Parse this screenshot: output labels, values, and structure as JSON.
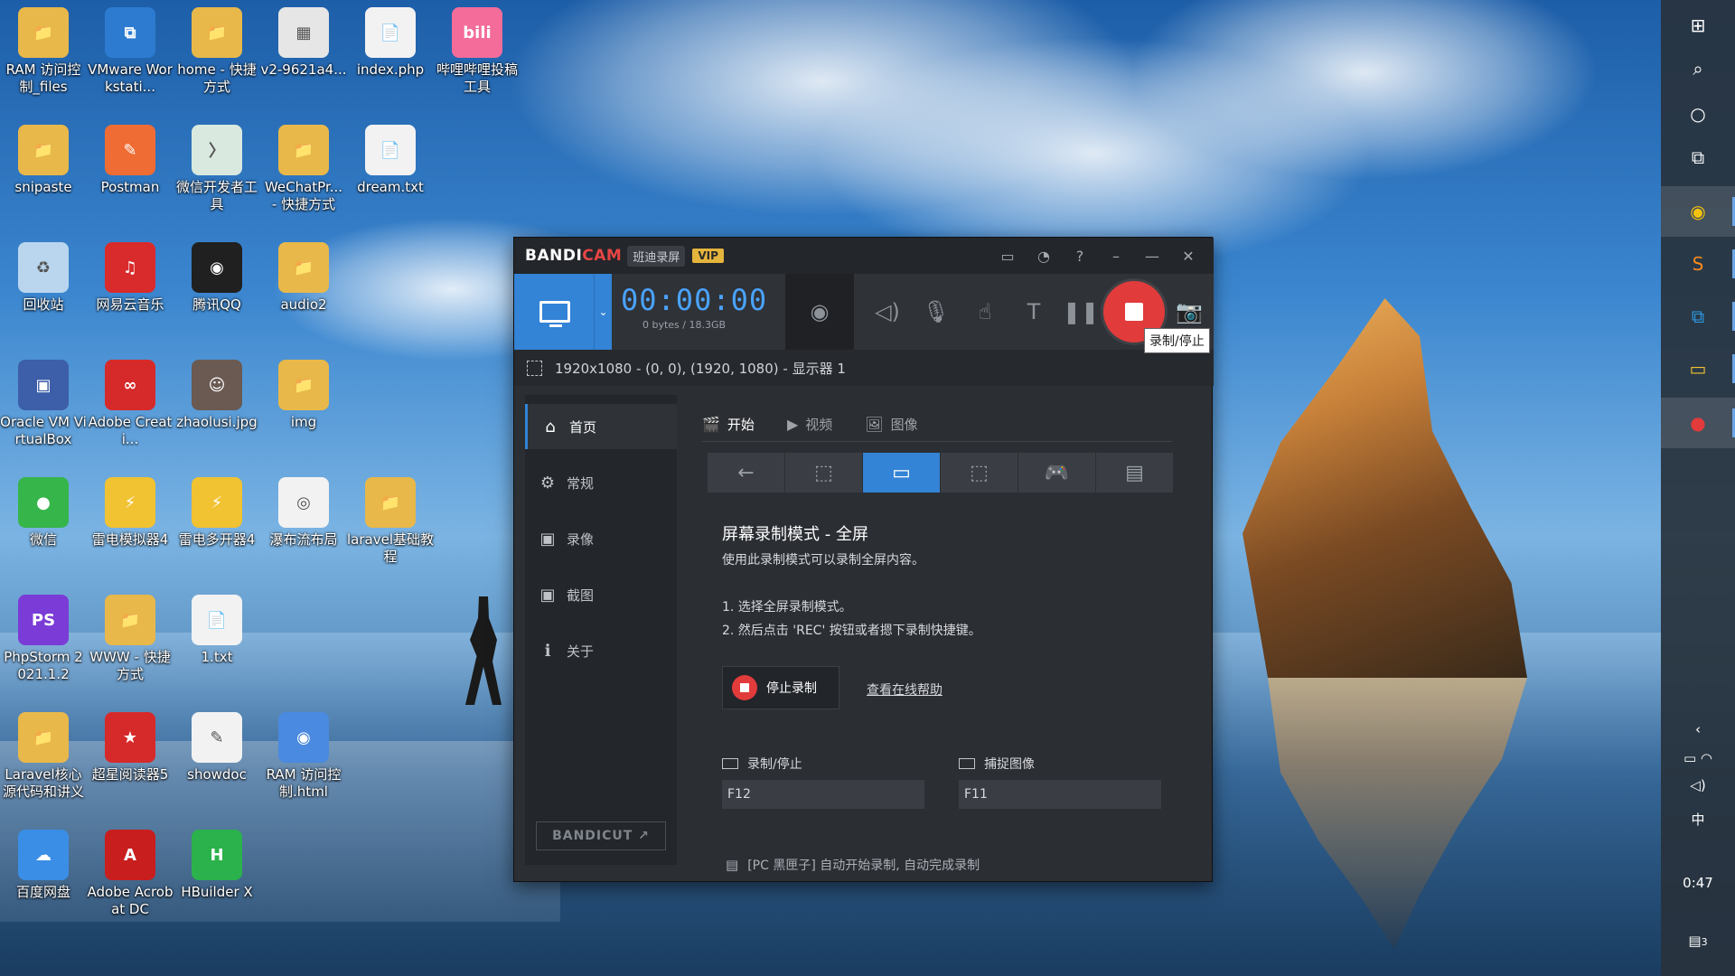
{
  "desktop": {
    "icons": [
      {
        "label": "RAM 访问控制_files",
        "glyph": "📁",
        "color": "#e8b84a"
      },
      {
        "label": "VMware Workstati...",
        "glyph": "⧉",
        "color": "#2c7bd1"
      },
      {
        "label": "home - 快捷方式",
        "glyph": "📁",
        "color": "#e8b84a"
      },
      {
        "label": "v2-9621a4...",
        "glyph": "▦",
        "color": "#e6e6e6"
      },
      {
        "label": "index.php",
        "glyph": "📄",
        "color": "#f2f2f2"
      },
      {
        "label": "哔哩哔哩投稿工具",
        "glyph": "bili",
        "color": "#f36c9a"
      },
      {
        "label": "snipaste",
        "glyph": "📁",
        "color": "#e8b84a"
      },
      {
        "label": "Postman",
        "glyph": "✎",
        "color": "#ef6c35"
      },
      {
        "label": "微信开发者工具",
        "glyph": "〉",
        "color": "#d9e9e0"
      },
      {
        "label": "WeChatPr... - 快捷方式",
        "glyph": "📁",
        "color": "#e8b84a"
      },
      {
        "label": "dream.txt",
        "glyph": "📄",
        "color": "#f2f2f2"
      },
      {
        "label": "回收站",
        "glyph": "♻",
        "color": "#b9d6ee"
      },
      {
        "label": "网易云音乐",
        "glyph": "♫",
        "color": "#d92b2b"
      },
      {
        "label": "腾讯QQ",
        "glyph": "◉",
        "color": "#202020"
      },
      {
        "label": "audio2",
        "glyph": "📁",
        "color": "#e8b84a"
      },
      {
        "label": "Oracle VM VirtualBox",
        "glyph": "▣",
        "color": "#3d5ea8"
      },
      {
        "label": "Adobe Creati...",
        "glyph": "∞",
        "color": "#d62a2a"
      },
      {
        "label": "zhaolusi.jpg",
        "glyph": "☺",
        "color": "#6b5a52"
      },
      {
        "label": "img",
        "glyph": "📁",
        "color": "#e8b84a"
      },
      {
        "label": "微信",
        "glyph": "●",
        "color": "#36b54a"
      },
      {
        "label": "雷电模拟器4",
        "glyph": "⚡",
        "color": "#f1c232"
      },
      {
        "label": "雷电多开器4",
        "glyph": "⚡",
        "color": "#f1c232"
      },
      {
        "label": "瀑布流布局",
        "glyph": "◎",
        "color": "#f2f2f2"
      },
      {
        "label": "laravel基础教程",
        "glyph": "📁",
        "color": "#e8b84a"
      },
      {
        "label": "PhpStorm 2021.1.2",
        "glyph": "PS",
        "color": "#7a3bd6"
      },
      {
        "label": "WWW - 快捷方式",
        "glyph": "📁",
        "color": "#e8b84a"
      },
      {
        "label": "1.txt",
        "glyph": "📄",
        "color": "#f2f2f2"
      },
      {
        "label": "Laravel核心源代码和讲义",
        "glyph": "📁",
        "color": "#e8b84a"
      },
      {
        "label": "超星阅读器5",
        "glyph": "★",
        "color": "#d62a2a"
      },
      {
        "label": "showdoc",
        "glyph": "✎",
        "color": "#f2f2f2"
      },
      {
        "label": "RAM 访问控制.html",
        "glyph": "◉",
        "color": "#4a8ae0"
      },
      {
        "label": "百度网盘",
        "glyph": "☁",
        "color": "#3a8ee6"
      },
      {
        "label": "Adobe Acrobat DC",
        "glyph": "A",
        "color": "#c81e1e"
      },
      {
        "label": "HBuilder X",
        "glyph": "H",
        "color": "#2bb24c"
      }
    ]
  },
  "taskbar": {
    "start_icon": "windows-logo-icon",
    "time": "0:47",
    "ime": "中",
    "notification_count": "3"
  },
  "bandicam": {
    "logo_main": "BANDI",
    "logo_accent": "CAM",
    "cn_name": "班迪录屏",
    "vip": "VIP",
    "timer": "00:00:00",
    "size": "0 bytes / 18.3GB",
    "tooltip": "录制/停止",
    "region_text": "1920x1080 - (0, 0), (1920, 1080) - 显示器 1",
    "nav": [
      {
        "label": "首页",
        "icon": "home-icon",
        "glyph": "⌂"
      },
      {
        "label": "常规",
        "icon": "gear-icon",
        "glyph": "⚙"
      },
      {
        "label": "录像",
        "icon": "video-settings-icon",
        "glyph": "▣"
      },
      {
        "label": "截图",
        "icon": "screenshot-settings-icon",
        "glyph": "▣"
      },
      {
        "label": "关于",
        "icon": "info-icon",
        "glyph": "ℹ"
      }
    ],
    "bandicut": "BANDICUT ↗",
    "tabs": [
      {
        "label": "开始",
        "glyph": "🎬"
      },
      {
        "label": "视频",
        "glyph": "▶"
      },
      {
        "label": "图像",
        "glyph": "🖼"
      }
    ],
    "mode_heading": "屏幕录制模式 - 全屏",
    "mode_desc": "使用此录制模式可以录制全屏内容。",
    "step1": "1. 选择全屏录制模式。",
    "step2": "2. 然后点击 'REC' 按钮或者摁下录制快捷键。",
    "stop_button": "停止录制",
    "help_link": "查看在线帮助",
    "hotkey_record_label": "录制/停止",
    "hotkey_record_value": "F12",
    "hotkey_capture_label": "捕捉图像",
    "hotkey_capture_value": "F11",
    "footer": "[PC 黑匣子] 自动开始录制, 自动完成录制"
  }
}
